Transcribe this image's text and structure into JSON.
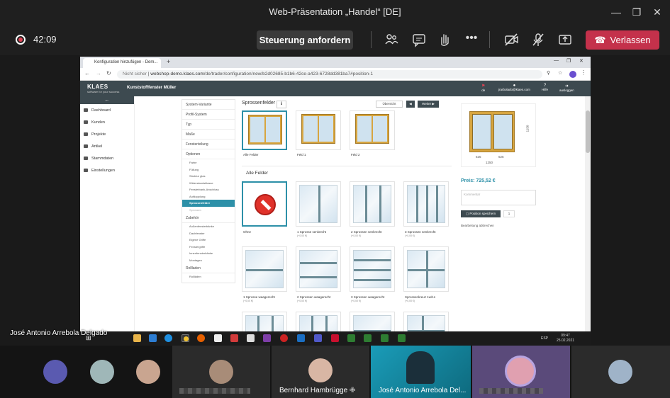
{
  "window": {
    "title": "Web-Präsentation „Handel“ [DE]"
  },
  "toolbar": {
    "timer": "42:09",
    "request_control_label": "Steuerung anfordern",
    "leave_label": "Verlassen"
  },
  "browser": {
    "tab_title": "Konfiguration hinzufügen - Dem...",
    "not_secure": "Nicht sicher",
    "url_host": "webshop-demo.klaes.com",
    "url_path": "/de/trader/configuration/new/b2d02685-b1b6-42ce-a423-6728dd381ba7#position-1"
  },
  "app": {
    "logo": "KLAES",
    "logo_sub": "software for your success",
    "firm": "Kunststofffenster Müller",
    "header_items": [
      "de",
      "jrarbolado@klaes.com",
      "Hilfe",
      "ausloggen"
    ],
    "sidebar": [
      {
        "label": "Dashboard"
      },
      {
        "label": "Kunden"
      },
      {
        "label": "Projekte"
      },
      {
        "label": "Artikel"
      },
      {
        "label": "Stammdaten"
      },
      {
        "label": "Einstellungen"
      }
    ],
    "steps": [
      {
        "label": "System-Variante",
        "type": "main"
      },
      {
        "label": "Profil-System",
        "type": "main"
      },
      {
        "label": "Typ",
        "type": "main"
      },
      {
        "label": "Maße",
        "type": "main"
      },
      {
        "label": "Fensterteilung",
        "type": "main"
      },
      {
        "label": "Optionen",
        "type": "main"
      },
      {
        "label": "Farbe",
        "type": "sub"
      },
      {
        "label": "Füllung",
        "type": "sub"
      },
      {
        "label": "Struktur glas",
        "type": "sub"
      },
      {
        "label": "Widerstandsklasse",
        "type": "sub"
      },
      {
        "label": "Fensterbank-Anschluss",
        "type": "sub"
      },
      {
        "label": "Aufdopplung",
        "type": "sub"
      },
      {
        "label": "Sprossenfelder",
        "type": "active"
      },
      {
        "label": "Sprossen",
        "type": "dim"
      },
      {
        "label": "Zubehör",
        "type": "main"
      },
      {
        "label": "Außenfensterbänke",
        "type": "sub"
      },
      {
        "label": "Dachfenster",
        "type": "sub"
      },
      {
        "label": "Eigene Griffe",
        "type": "sub"
      },
      {
        "label": "Fenstergriffe",
        "type": "sub"
      },
      {
        "label": "Innenfensterbänke",
        "type": "sub"
      },
      {
        "label": "Montagen",
        "type": "sub"
      },
      {
        "label": "Rollladen",
        "type": "main"
      },
      {
        "label": "Rollläden",
        "type": "sub"
      }
    ],
    "content": {
      "title": "Sprossenfelder",
      "overview": "Übersicht",
      "next": "Weiter",
      "fields": [
        "Alle Felder",
        "Feld 1",
        "Feld 2"
      ],
      "section": "Alle Felder",
      "options": [
        {
          "label": "Ohne",
          "price": ""
        },
        {
          "label": "1 Sprosse senkrecht",
          "price": "(+0,00 €)"
        },
        {
          "label": "2 Sprossen senkrecht",
          "price": "(+0,00 €)"
        },
        {
          "label": "3 Sprossen senkrecht",
          "price": "(+0,00 €)"
        },
        {
          "label": "1 Sprosse waagerecht",
          "price": "(+0,00 €)"
        },
        {
          "label": "2 Sprossen waagerecht",
          "price": "(+0,00 €)"
        },
        {
          "label": "3 Sprossen waagerecht",
          "price": "(+0,00 €)"
        },
        {
          "label": "Sprossenkreuz 1w/1s",
          "price": "(+0,00 €)"
        }
      ]
    },
    "right": {
      "dim_height": "1150",
      "dim_left": "625",
      "dim_right": "625",
      "dim_total": "1250",
      "price": "Preis: 725,52 €",
      "comment_placeholder": "Kommentar",
      "save_label": "Position speichern",
      "qty": "1",
      "abort_label": "Bearbeitung abbrechen"
    }
  },
  "taskbar": {
    "lang": "ESP",
    "time": "09:47",
    "date": "25.02.2021"
  },
  "presenter_name": "José Antonio Arrebola Delgado",
  "participants": [
    {
      "name": "Bernhard Hambrügge"
    },
    {
      "name": "José Antonio Arrebola Del..."
    }
  ],
  "colors": {
    "accent": "#2d90a8",
    "leave": "#c4314b",
    "app_header": "#3d4a50"
  }
}
